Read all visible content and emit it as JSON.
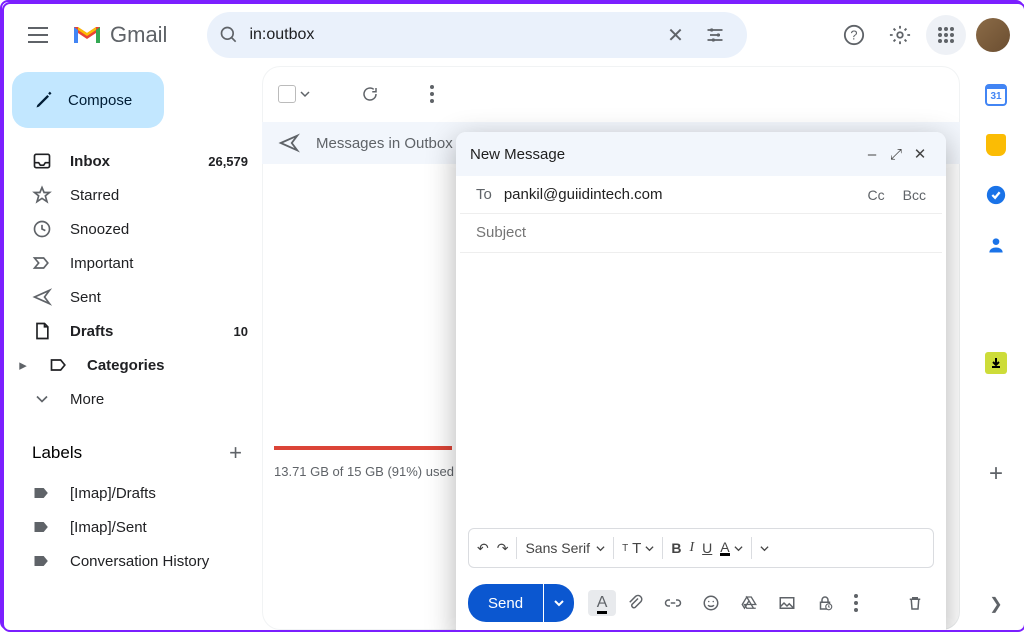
{
  "app": {
    "name": "Gmail"
  },
  "search": {
    "query": "in:outbox"
  },
  "compose_button": "Compose",
  "nav": [
    {
      "icon": "inbox",
      "label": "Inbox",
      "count": "26,579",
      "bold": true
    },
    {
      "icon": "star",
      "label": "Starred",
      "count": ""
    },
    {
      "icon": "clock",
      "label": "Snoozed",
      "count": ""
    },
    {
      "icon": "important",
      "label": "Important",
      "count": ""
    },
    {
      "icon": "send",
      "label": "Sent",
      "count": ""
    },
    {
      "icon": "file",
      "label": "Drafts",
      "count": "10",
      "bold": true
    },
    {
      "icon": "category",
      "label": "Categories",
      "count": "",
      "bold": true,
      "caret": true
    },
    {
      "icon": "chevdown",
      "label": "More",
      "count": ""
    }
  ],
  "labels_header": "Labels",
  "labels": [
    {
      "label": "[Imap]/Drafts"
    },
    {
      "label": "[Imap]/Sent"
    },
    {
      "label": "Conversation History"
    }
  ],
  "outbox_banner": "Messages in Outbox",
  "storage_text": "13.71 GB of 15 GB (91%) used",
  "compose_window": {
    "title": "New Message",
    "to_label": "To",
    "to_value": "pankil@guiidintech.com",
    "cc": "Cc",
    "bcc": "Bcc",
    "subject_placeholder": "Subject",
    "font_family": "Sans Serif",
    "send_label": "Send"
  },
  "sidepanel": {
    "calendar_day": "31"
  }
}
